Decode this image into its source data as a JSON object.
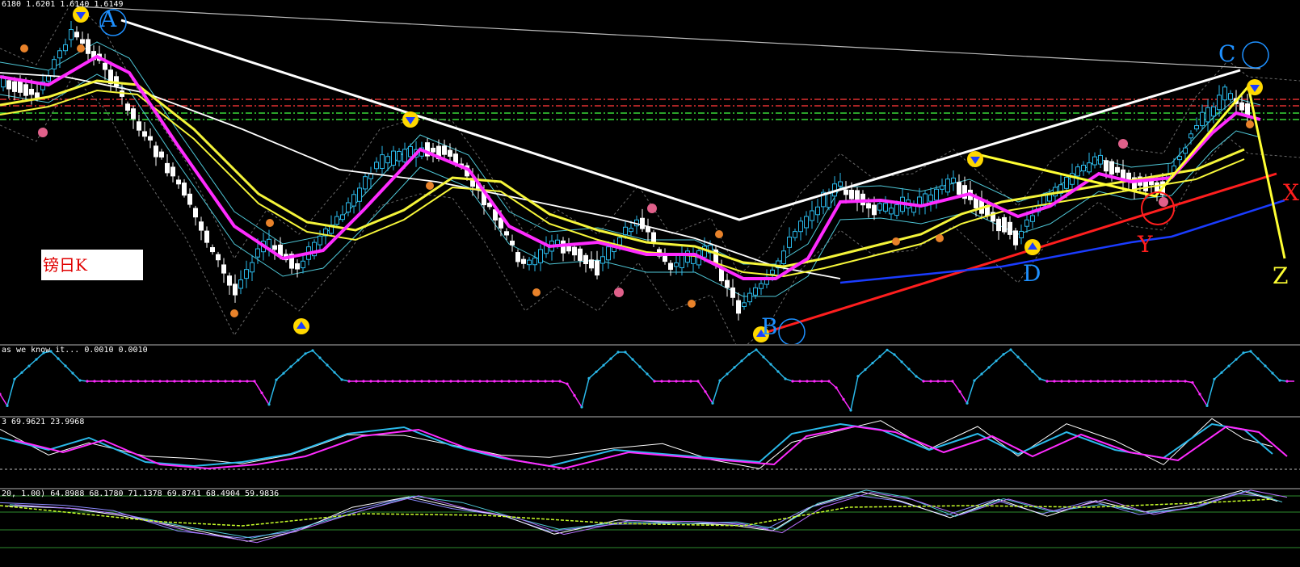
{
  "main": {
    "ohlc_text": "6180 1.6201 1.6140 1.6149",
    "label_box": "镑日K",
    "annotations": {
      "A": "A",
      "B": "B",
      "C": "C",
      "D": "D",
      "X": "X",
      "Y": "Y",
      "Z": "Z"
    }
  },
  "indicators": [
    {
      "text": "as we know it...  0.0010 0.0010"
    },
    {
      "text": "3 69.9621 23.9968"
    },
    {
      "text": "20, 1.00) 64.8988 68.1780 71.1378 69.8741 68.4904 59.9836"
    }
  ],
  "colors": {
    "background": "#000000",
    "bull_candle": "#2ab9ea",
    "bear_candle": "#ffffff",
    "ma_magenta": "#ff2bff",
    "ma_yellow": "#f5f53a",
    "trend_white": "#ffffff",
    "trend_red": "#ff1e1e",
    "trend_blue": "#1a3cff",
    "zigzag_yellow": "#ffff33",
    "annotation_blue": "#1e90ff",
    "annotation_red": "#ff1e1e",
    "annotation_yellow": "#ffff33",
    "resistance_red": "#e03030",
    "support_green": "#38d838"
  }
}
